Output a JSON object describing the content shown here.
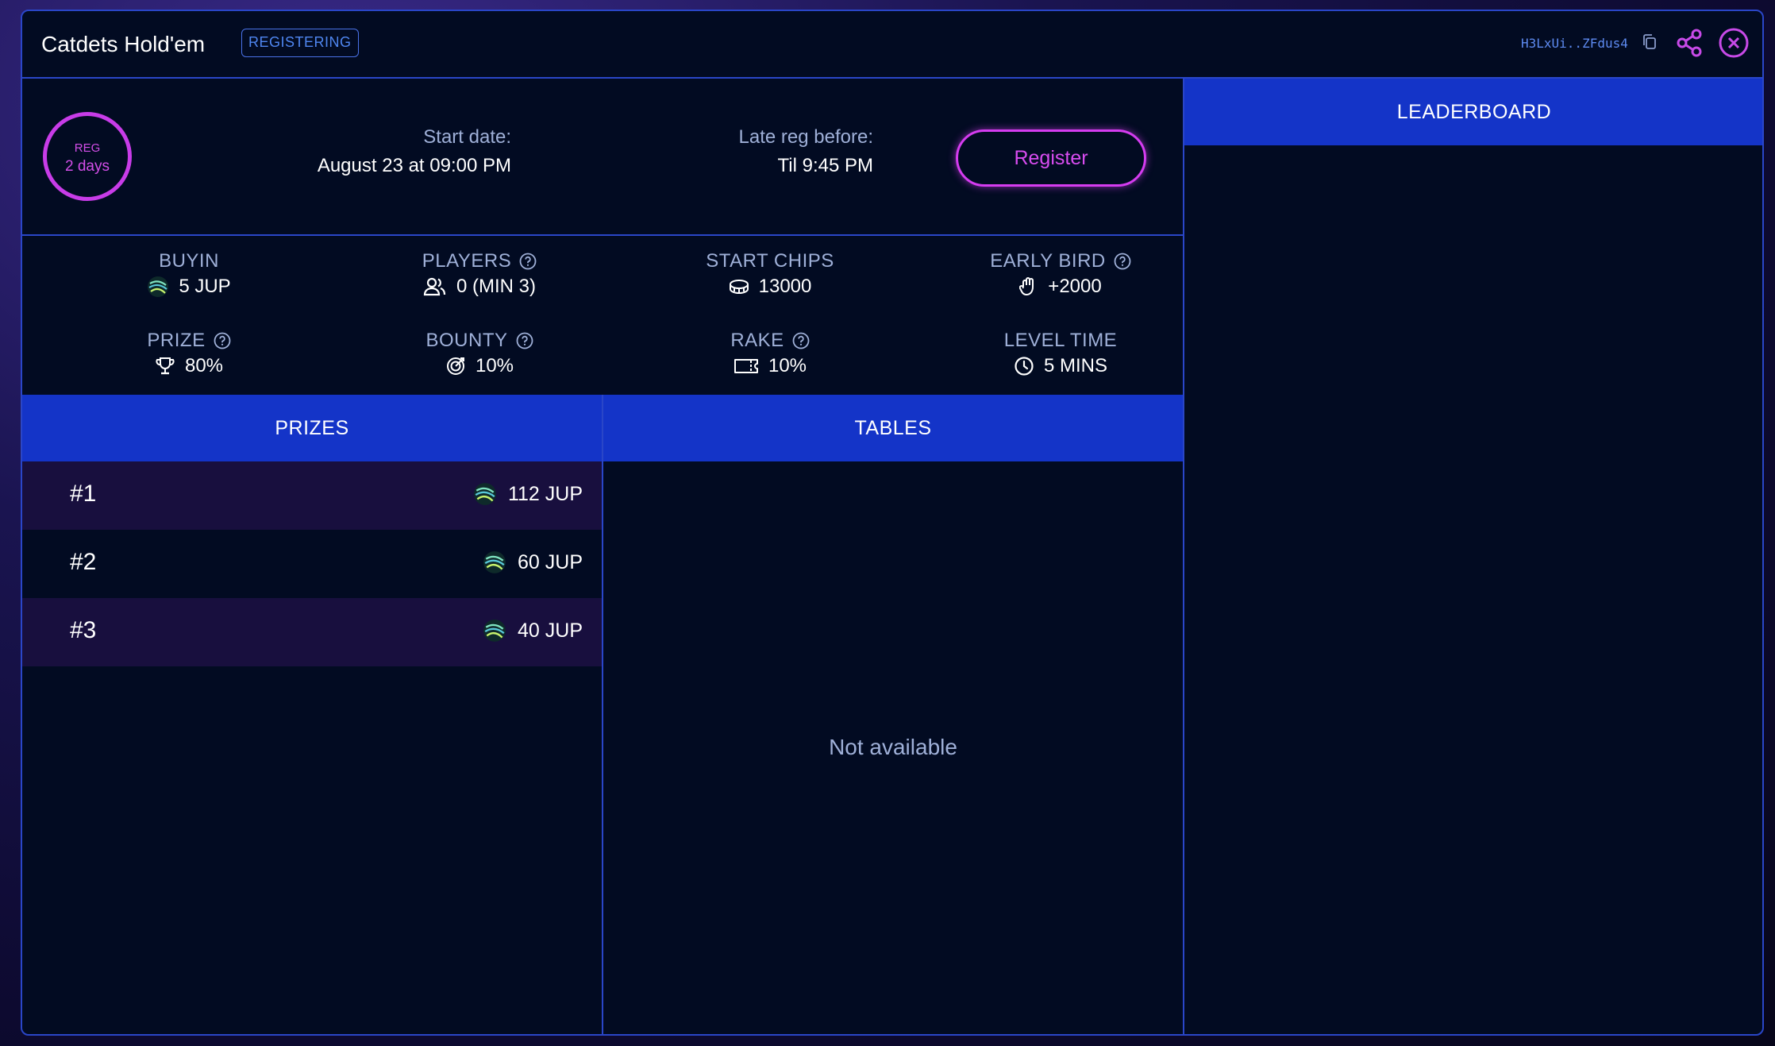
{
  "header": {
    "title": "Catdets Hold'em",
    "status_badge": "REGISTERING",
    "tournament_id": "H3LxUi..ZFdus4"
  },
  "reg_timer": {
    "label": "REG",
    "value": "2 days"
  },
  "schedule": {
    "start_label": "Start date:",
    "start_value": "August 23 at 09:00 PM",
    "late_reg_label": "Late reg before:",
    "late_reg_value": "Til 9:45 PM"
  },
  "register_button": "Register",
  "stats": {
    "buyin": {
      "label": "BUYIN",
      "value": "5 JUP"
    },
    "players": {
      "label": "PLAYERS",
      "value": "0 (MIN 3)"
    },
    "start_chips": {
      "label": "START CHIPS",
      "value": "13000"
    },
    "early_bird": {
      "label": "EARLY BIRD",
      "value": "+2000"
    },
    "prize": {
      "label": "PRIZE",
      "value": "80%"
    },
    "bounty": {
      "label": "BOUNTY",
      "value": "10%"
    },
    "rake": {
      "label": "RAKE",
      "value": "10%"
    },
    "level_time": {
      "label": "LEVEL TIME",
      "value": "5 MINS"
    }
  },
  "prizes": {
    "title": "PRIZES",
    "rows": [
      {
        "rank": "#1",
        "amount": "112 JUP"
      },
      {
        "rank": "#2",
        "amount": "60 JUP"
      },
      {
        "rank": "#3",
        "amount": "40 JUP"
      }
    ]
  },
  "tables": {
    "title": "TABLES",
    "empty_text": "Not available"
  },
  "leaderboard": {
    "title": "LEADERBOARD"
  },
  "colors": {
    "accent_blue": "#1434c8",
    "accent_pink": "#d53cf0",
    "border": "#2a46c8",
    "panel_bg": "#020b22"
  },
  "icons": [
    "copy-icon",
    "share-icon",
    "close-icon",
    "jup-token-icon",
    "users-icon",
    "chips-icon",
    "hand-icon",
    "trophy-icon",
    "target-icon",
    "ticket-icon",
    "clock-icon",
    "help-icon"
  ]
}
